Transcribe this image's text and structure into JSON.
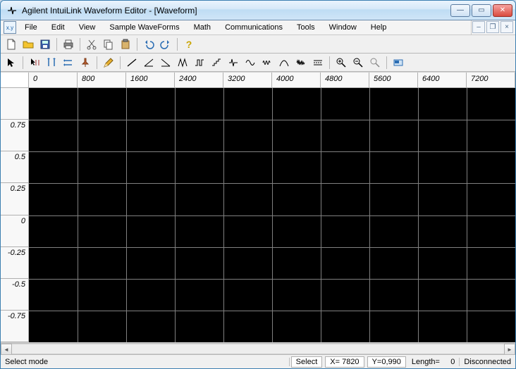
{
  "window": {
    "title": "Agilent IntuiLink Waveform Editor - [Waveform]"
  },
  "menu": {
    "items": [
      "File",
      "Edit",
      "View",
      "Sample WaveForms",
      "Math",
      "Communications",
      "Tools",
      "Window",
      "Help"
    ]
  },
  "toolbar1": {
    "icons": [
      "new-file-icon",
      "open-icon",
      "save-icon",
      "sep",
      "print-icon",
      "sep",
      "cut-icon",
      "copy-icon",
      "paste-icon",
      "sep",
      "undo-icon",
      "redo-icon",
      "sep",
      "help-icon"
    ]
  },
  "toolbar2": {
    "icons": [
      "pointer-icon",
      "sep",
      "marker-select-icon",
      "xmarker-icon",
      "ymarker-icon",
      "pin-icon",
      "sep",
      "pencil-icon",
      "sep",
      "line-icon",
      "ramp-up-icon",
      "ramp-down-icon",
      "triangle-icon",
      "square-icon",
      "staircase-icon",
      "pulse-icon",
      "sine-icon",
      "waveform-icon",
      "curve-icon",
      "noise-icon",
      "dc-icon",
      "sep",
      "zoom-in-icon",
      "zoom-out-icon",
      "zoom-reset-icon",
      "sep",
      "device-icon"
    ]
  },
  "chart_data": {
    "type": "line",
    "xlabel": "",
    "ylabel": "",
    "categories": [
      "0",
      "800",
      "1600",
      "2400",
      "3200",
      "4000",
      "4800",
      "5600",
      "6400",
      "7200"
    ],
    "y_ticks": [
      "",
      "0.75",
      "0.5",
      "0.25",
      "0",
      "-0.25",
      "-0.5",
      "-0.75"
    ],
    "xlim": [
      0,
      8000
    ],
    "ylim": [
      -1,
      1
    ],
    "series": [],
    "grid": true,
    "background": "#000000"
  },
  "status": {
    "mode": "Select mode",
    "select_label": "Select",
    "x_label": "X=",
    "x_value": "7820",
    "y_label": "Y=",
    "y_value": "0,990",
    "length_label": "Length=",
    "length_value": "0",
    "conn": "Disconnected"
  },
  "icons": {
    "min": "—",
    "max": "▭",
    "close": "✕",
    "mdi_min": "–",
    "mdi_max": "❐",
    "mdi_close": "×",
    "left": "◄",
    "right": "►"
  }
}
